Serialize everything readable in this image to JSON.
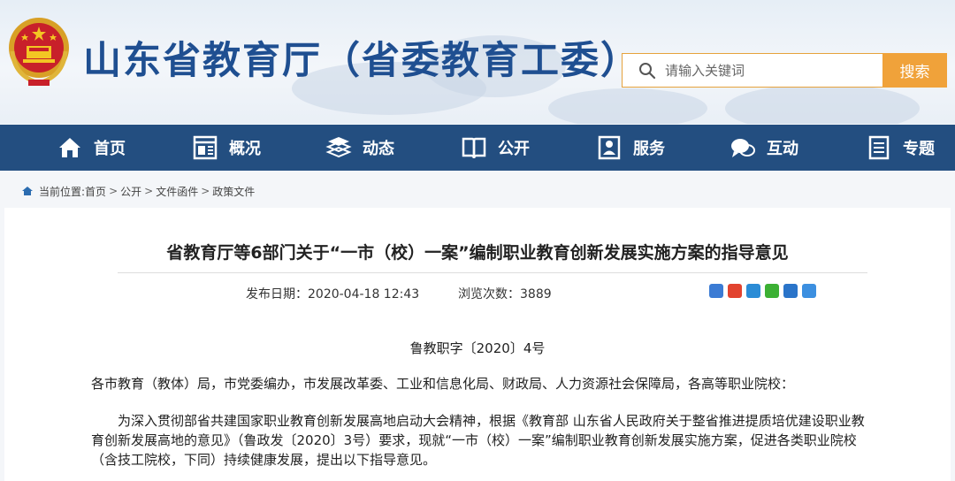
{
  "header": {
    "site_title": "山东省教育厅（省委教育工委）",
    "search_placeholder": "请输入关键词",
    "search_button": "搜索"
  },
  "nav": {
    "items": [
      {
        "label": "首页",
        "icon": "home-icon"
      },
      {
        "label": "概况",
        "icon": "overview-icon"
      },
      {
        "label": "动态",
        "icon": "news-icon"
      },
      {
        "label": "公开",
        "icon": "book-icon"
      },
      {
        "label": "服务",
        "icon": "service-icon"
      },
      {
        "label": "互动",
        "icon": "chat-icon"
      },
      {
        "label": "专题",
        "icon": "topic-icon"
      }
    ]
  },
  "breadcrumb": {
    "prefix": "当前位置:",
    "items": [
      "首页",
      "公开",
      "文件函件",
      "政策文件"
    ],
    "separator": ">"
  },
  "article": {
    "title": "省教育厅等6部门关于“一市（校）一案”编制职业教育创新发展实施方案的指导意见",
    "publish_label": "发布日期：",
    "publish_date": "2020-04-18 12:43",
    "views_label": "浏览次数：",
    "views": "3889",
    "doc_number": "鲁教职字〔2020〕4号",
    "salutation": "各市教育（教体）局，市党委编办，市发展改革委、工业和信息化局、财政局、人力资源社会保障局，各高等职业院校：",
    "paragraph_1": "为深入贯彻部省共建国家职业教育创新发展高地启动大会精神，根据《教育部 山东省人民政府关于整省推进提质培优建设职业教育创新发展高地的意见》（鲁政发〔2020〕3号）要求，现就“一市（校）一案”编制职业教育创新发展实施方案，促进各类职业院校（含技工院校，下同）持续健康发展，提出以下指导意见。"
  },
  "colors": {
    "title_blue": "#1f4f91",
    "nav_bg": "#234e80",
    "search_orange": "#f0a23a"
  }
}
